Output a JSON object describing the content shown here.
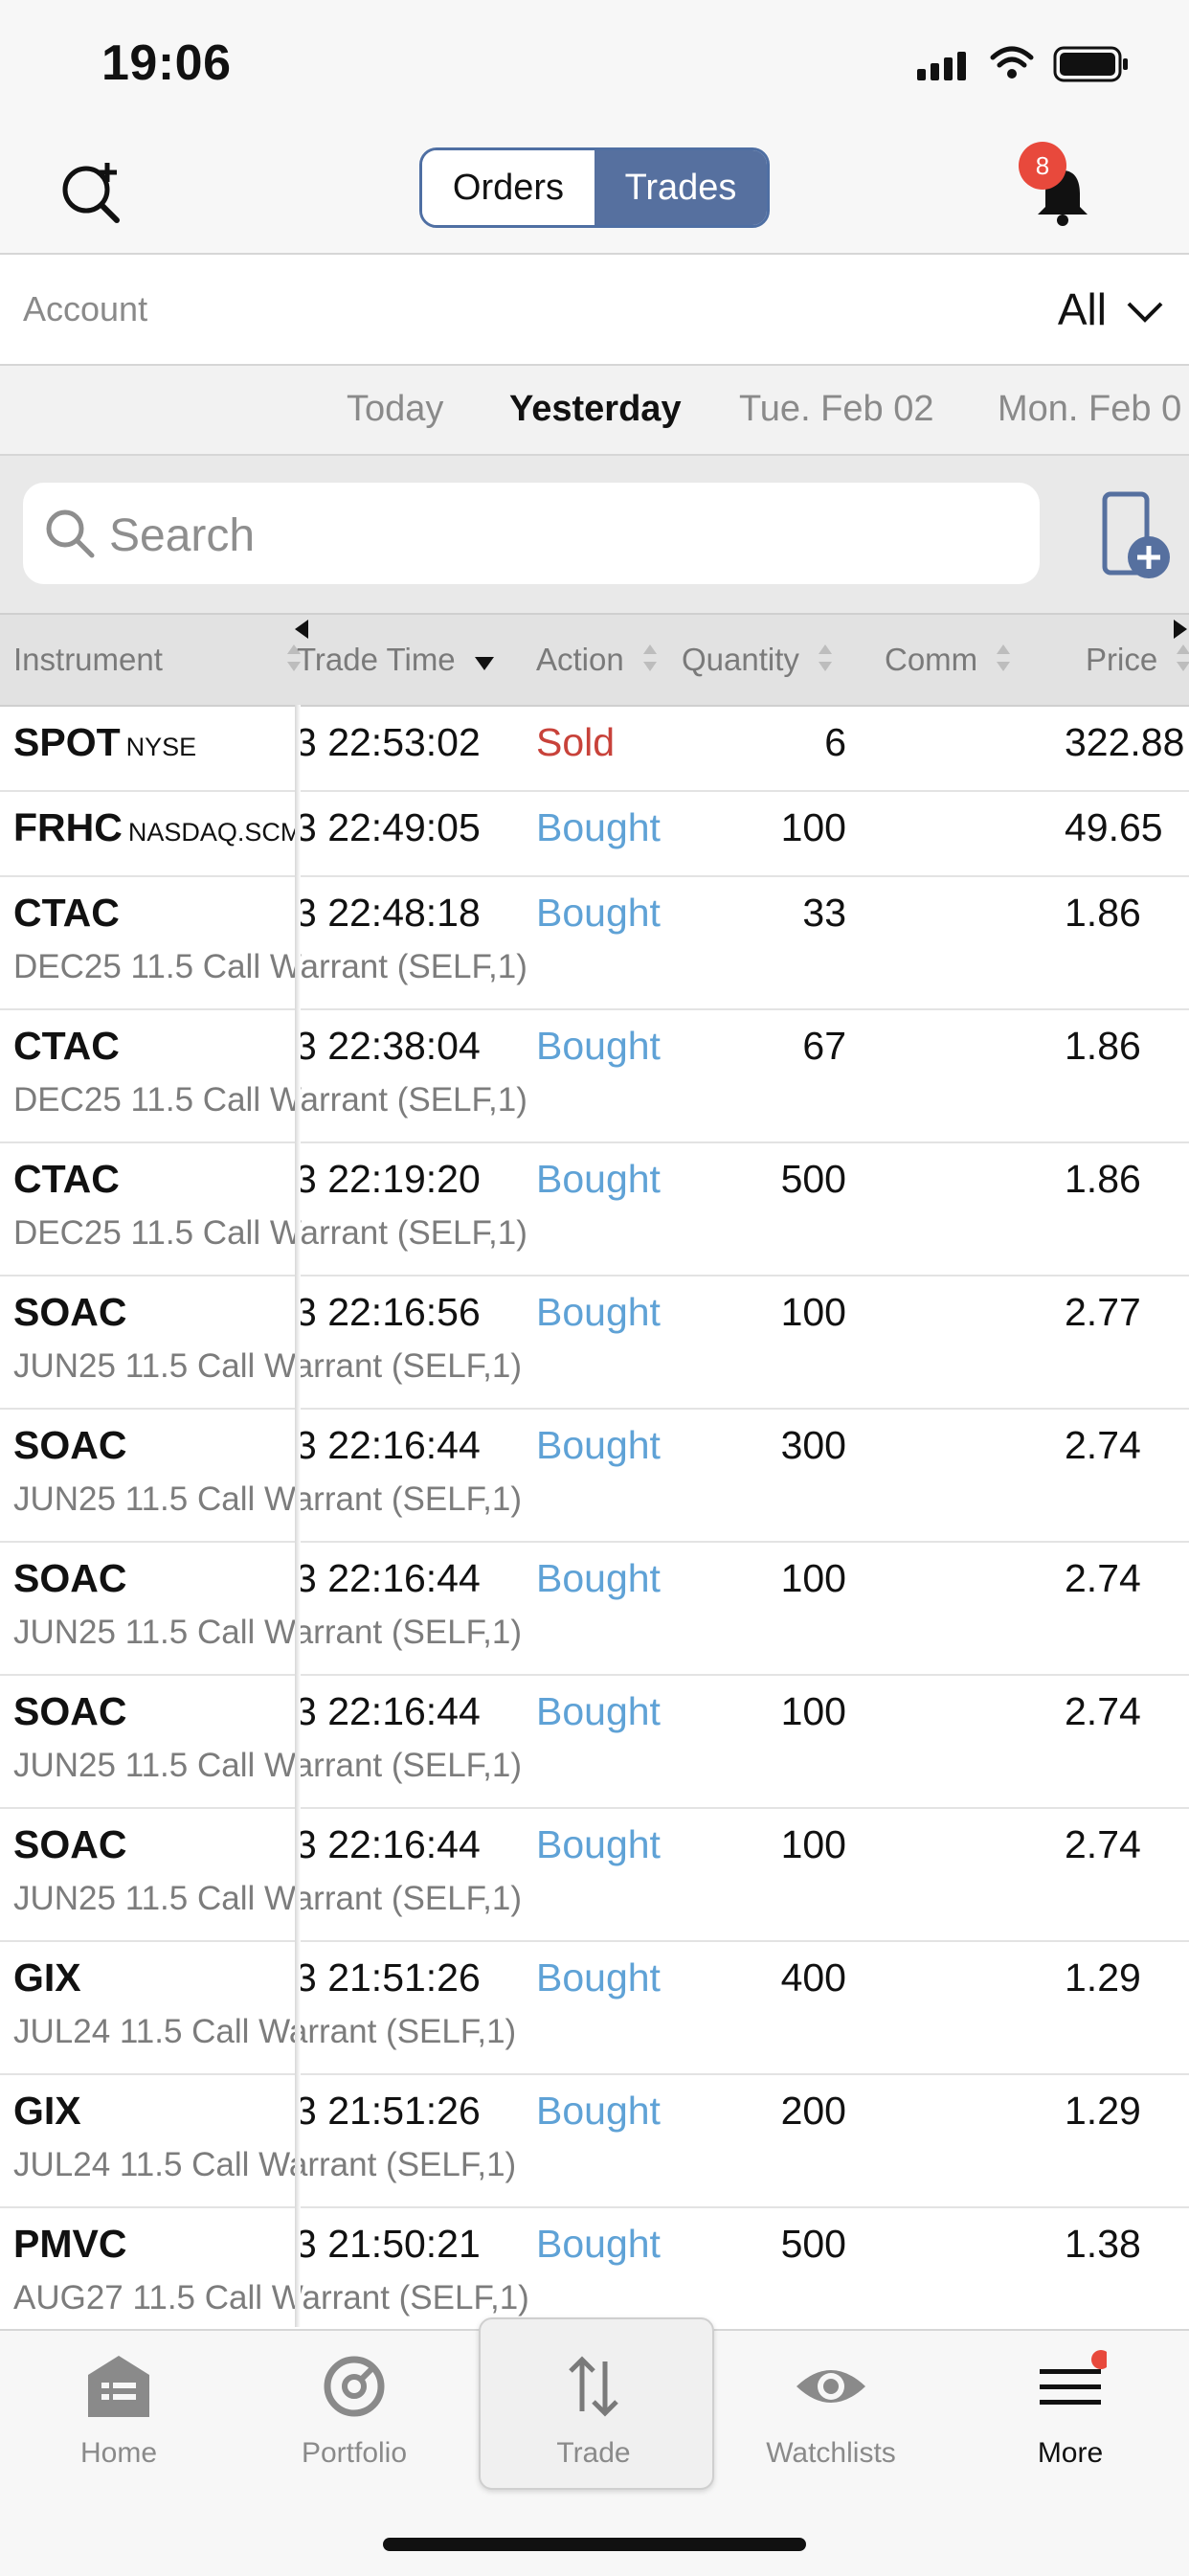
{
  "status": {
    "time": "19:06"
  },
  "header": {
    "segments": [
      "Orders",
      "Trades"
    ],
    "selected": "Trades",
    "notification_count": "8"
  },
  "account": {
    "label": "Account",
    "value": "All"
  },
  "date_tabs": [
    "Today",
    "Yesterday",
    "Tue. Feb 02",
    "Mon. Feb 0"
  ],
  "search": {
    "placeholder": "Search"
  },
  "columns": [
    "Instrument",
    "Trade Time",
    "Action",
    "Quantity",
    "Comm",
    "Price"
  ],
  "trades": [
    {
      "symbol": "SPOT",
      "exchange": "NYSE",
      "desc": "",
      "time": "3 22:53:02",
      "action": "Sold",
      "qty": "6",
      "price": "322.88"
    },
    {
      "symbol": "FRHC",
      "exchange": "NASDAQ.SCM",
      "desc": "",
      "time": "3 22:49:05",
      "action": "Bought",
      "qty": "100",
      "price": "49.65"
    },
    {
      "symbol": "CTAC",
      "exchange": "",
      "desc": "DEC25 11.5 Call Warrant (SELF,1)",
      "time": "3 22:48:18",
      "action": "Bought",
      "qty": "33",
      "price": "1.86"
    },
    {
      "symbol": "CTAC",
      "exchange": "",
      "desc": "DEC25 11.5 Call Warrant (SELF,1)",
      "time": "3 22:38:04",
      "action": "Bought",
      "qty": "67",
      "price": "1.86"
    },
    {
      "symbol": "CTAC",
      "exchange": "",
      "desc": "DEC25 11.5 Call Warrant (SELF,1)",
      "time": "3 22:19:20",
      "action": "Bought",
      "qty": "500",
      "price": "1.86"
    },
    {
      "symbol": "SOAC",
      "exchange": "",
      "desc": "JUN25 11.5 Call Warrant (SELF,1)",
      "time": "3 22:16:56",
      "action": "Bought",
      "qty": "100",
      "price": "2.77"
    },
    {
      "symbol": "SOAC",
      "exchange": "",
      "desc": "JUN25 11.5 Call Warrant (SELF,1)",
      "time": "3 22:16:44",
      "action": "Bought",
      "qty": "300",
      "price": "2.74"
    },
    {
      "symbol": "SOAC",
      "exchange": "",
      "desc": "JUN25 11.5 Call Warrant (SELF,1)",
      "time": "3 22:16:44",
      "action": "Bought",
      "qty": "100",
      "price": "2.74"
    },
    {
      "symbol": "SOAC",
      "exchange": "",
      "desc": "JUN25 11.5 Call Warrant (SELF,1)",
      "time": "3 22:16:44",
      "action": "Bought",
      "qty": "100",
      "price": "2.74"
    },
    {
      "symbol": "SOAC",
      "exchange": "",
      "desc": "JUN25 11.5 Call Warrant (SELF,1)",
      "time": "3 22:16:44",
      "action": "Bought",
      "qty": "100",
      "price": "2.74"
    },
    {
      "symbol": "GIX",
      "exchange": "",
      "desc": "JUL24 11.5 Call Warrant (SELF,1)",
      "time": "3 21:51:26",
      "action": "Bought",
      "qty": "400",
      "price": "1.29"
    },
    {
      "symbol": "GIX",
      "exchange": "",
      "desc": "JUL24 11.5 Call Warrant (SELF,1)",
      "time": "3 21:51:26",
      "action": "Bought",
      "qty": "200",
      "price": "1.29"
    },
    {
      "symbol": "PMVC",
      "exchange": "",
      "desc": "AUG27 11.5 Call Warrant (SELF,1)",
      "time": "3 21:50:21",
      "action": "Bought",
      "qty": "500",
      "price": "1.38"
    }
  ],
  "colors": {
    "sold": "#c8423a",
    "bought": "#5fa2d6",
    "accent": "#56709f",
    "badge": "#e8493c"
  },
  "tabbar": [
    {
      "label": "Home",
      "icon": "home-icon"
    },
    {
      "label": "Portfolio",
      "icon": "portfolio-icon"
    },
    {
      "label": "Trade",
      "icon": "trade-icon"
    },
    {
      "label": "Watchlists",
      "icon": "eye-icon"
    },
    {
      "label": "More",
      "icon": "menu-icon"
    }
  ]
}
